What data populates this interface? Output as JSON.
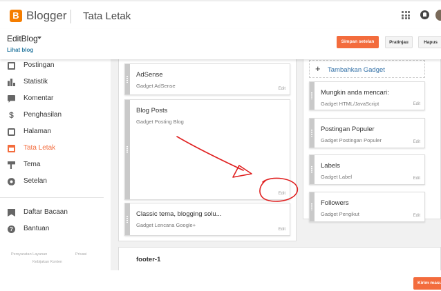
{
  "topbar": {
    "logo_letter": "B",
    "brand": "Blogger",
    "page_title": "Tata Letak"
  },
  "header": {
    "blog_name": "EditBlog",
    "view_blog": "Lihat blog",
    "save_label": "Simpan setelan",
    "preview_label": "Pratinjau",
    "delete_label": "Hapus"
  },
  "sidebar": {
    "items": [
      {
        "label": "Postingan",
        "icon": "posts-icon"
      },
      {
        "label": "Statistik",
        "icon": "stats-icon"
      },
      {
        "label": "Komentar",
        "icon": "comments-icon"
      },
      {
        "label": "Penghasilan",
        "icon": "earnings-icon"
      },
      {
        "label": "Halaman",
        "icon": "pages-icon"
      },
      {
        "label": "Tata Letak",
        "icon": "layout-icon",
        "active": true
      },
      {
        "label": "Tema",
        "icon": "theme-icon"
      },
      {
        "label": "Setelan",
        "icon": "settings-icon"
      },
      {
        "label": "Daftar Bacaan",
        "icon": "reading-list-icon"
      },
      {
        "label": "Bantuan",
        "icon": "help-icon"
      }
    ],
    "footer_links": {
      "terms": "Persyaratan Layanan",
      "privacy": "Privasi",
      "content_policy": "Kebijakan Konten"
    }
  },
  "layout": {
    "main_gadgets": [
      {
        "title": "AdSense",
        "subtitle": "Gadget AdSense",
        "edit": "Edit"
      },
      {
        "title": "Blog Posts",
        "subtitle": "Gadget Posting Blog",
        "edit": "Edit"
      },
      {
        "title": "Classic tema, blogging solu...",
        "subtitle": "Gadget Lencana Google+",
        "edit": "Edit"
      }
    ],
    "add_gadget": "Tambahkan Gadget",
    "sidebar_gadgets": [
      {
        "title": "Mungkin anda mencari:",
        "subtitle": "Gadget HTML/JavaScript",
        "edit": "Edit"
      },
      {
        "title": "Postingan Populer",
        "subtitle": "Gadget Postingan Populer",
        "edit": "Edit"
      },
      {
        "title": "Labels",
        "subtitle": "Gadget Label",
        "edit": "Edit"
      },
      {
        "title": "Followers",
        "subtitle": "Gadget Pengikut",
        "edit": "Edit"
      }
    ],
    "footer_section": "footer-1"
  },
  "feedback_label": "Kirim masukan",
  "colors": {
    "accent": "#f36c3d",
    "brand": "#f57d00",
    "link": "#2f6ea5",
    "annotation": "#e02020"
  }
}
